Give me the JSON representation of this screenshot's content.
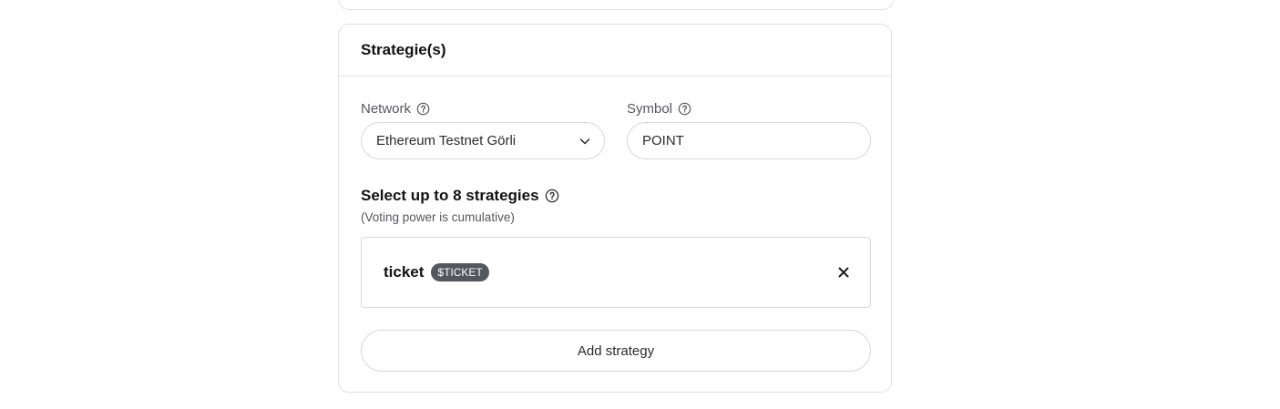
{
  "card": {
    "title": "Strategie(s)"
  },
  "network": {
    "label": "Network",
    "selected": "Ethereum Testnet Görli",
    "help_icon": "question-circle-icon",
    "dropdown_icon": "chevron-down-icon"
  },
  "symbol": {
    "label": "Symbol",
    "value": "POINT",
    "help_icon": "question-circle-icon"
  },
  "strategies": {
    "title": "Select up to 8 strategies",
    "subtitle": "(Voting power is cumulative)",
    "help_icon": "question-circle-icon",
    "items": [
      {
        "name": "ticket",
        "badge": "$TICKET",
        "remove_icon": "close-icon"
      }
    ],
    "add_label": "Add strategy"
  },
  "colors": {
    "border": "#e2e2e4",
    "input_border": "#d7d8db",
    "badge_bg": "#53575e",
    "text_primary": "#111214",
    "text_secondary": "#55575c"
  }
}
